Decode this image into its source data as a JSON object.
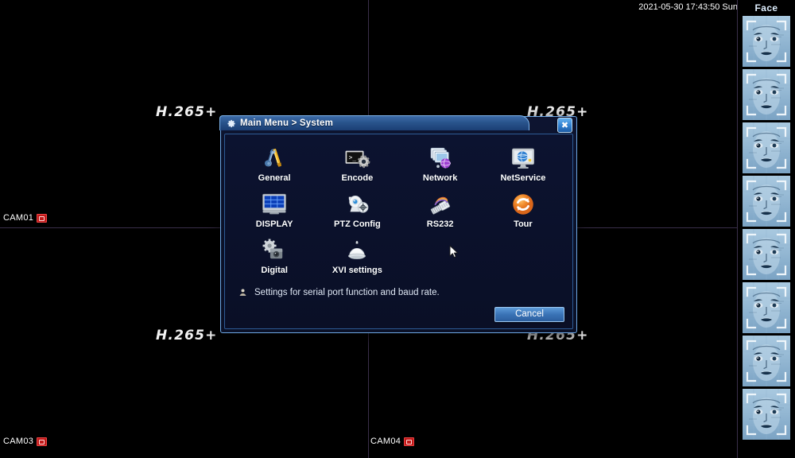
{
  "overlay": {
    "timestamp": "2021-05-30 17:43:50 Sun",
    "codec_watermark": "H.265+",
    "cameras": [
      {
        "name": "cam01",
        "label": "CAM01",
        "rec_icon": "record-icon"
      },
      {
        "name": "cam03",
        "label": "CAM03",
        "rec_icon": "record-icon"
      },
      {
        "name": "cam04",
        "label": "CAM04",
        "rec_icon": "record-icon"
      }
    ]
  },
  "face_panel": {
    "title": "Face",
    "thumbnail_count": 8,
    "thumbnail_icon": "face-scan-icon"
  },
  "dialog": {
    "title": "Main Menu > System",
    "title_icon": "gear-icon",
    "close_icon": "close-icon",
    "close_glyph": "✖",
    "menu_items": [
      {
        "id": "general",
        "label": "General",
        "icon": "wrench-screwdriver-icon"
      },
      {
        "id": "encode",
        "label": "Encode",
        "icon": "terminal-gear-icon"
      },
      {
        "id": "network",
        "label": "Network",
        "icon": "network-screens-icon"
      },
      {
        "id": "netservice",
        "label": "NetService",
        "icon": "monitor-globe-icon"
      },
      {
        "id": "display",
        "label": "DISPLAY",
        "icon": "monitor-grid-icon"
      },
      {
        "id": "ptzconfig",
        "label": "PTZ Config",
        "icon": "ptz-camera-icon"
      },
      {
        "id": "rs232",
        "label": "RS232",
        "icon": "serial-cable-icon"
      },
      {
        "id": "tour",
        "label": "Tour",
        "icon": "refresh-circle-icon"
      },
      {
        "id": "digital",
        "label": "Digital",
        "icon": "digital-camera-gear-icon"
      },
      {
        "id": "xvisettings",
        "label": "XVI settings",
        "icon": "dome-camera-icon"
      }
    ],
    "hint": {
      "icon": "info-pin-icon",
      "text": "Settings for serial port function and baud rate."
    },
    "buttons": {
      "cancel": "Cancel"
    }
  },
  "colors": {
    "dialog_border": "#6ea8e6",
    "dialog_bg": "#0b1128",
    "titlebar": "#29548c",
    "accent_blue": "#3a73b6",
    "record_red": "#c01818",
    "tour_orange": "#f08420",
    "grid_line": "#3a2f4a"
  }
}
